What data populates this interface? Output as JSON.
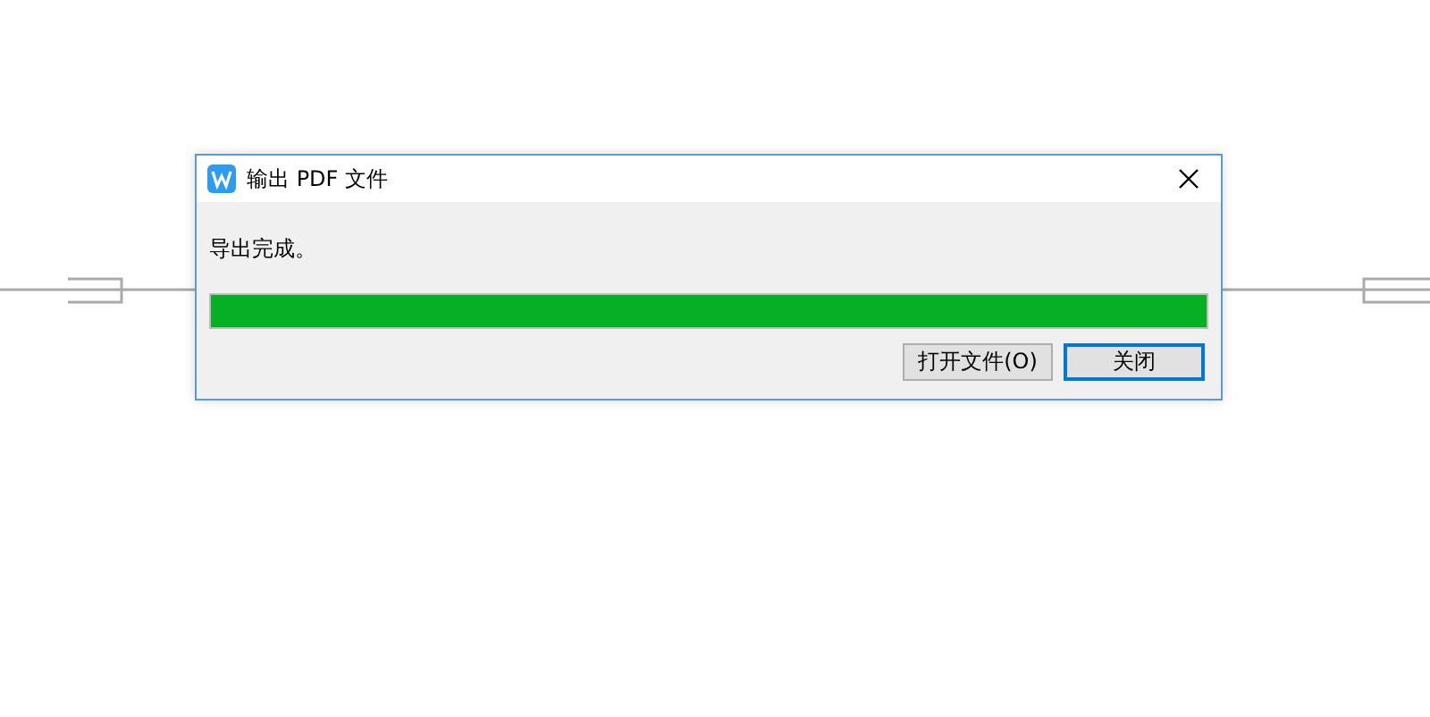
{
  "window": {
    "title": "输出 PDF 文件"
  },
  "message": "导出完成。",
  "progress": {
    "level": 1
  },
  "buttons": [
    {
      "label": "打开文件(O)",
      "default": false
    },
    {
      "label": "关闭",
      "default": true
    }
  ]
}
